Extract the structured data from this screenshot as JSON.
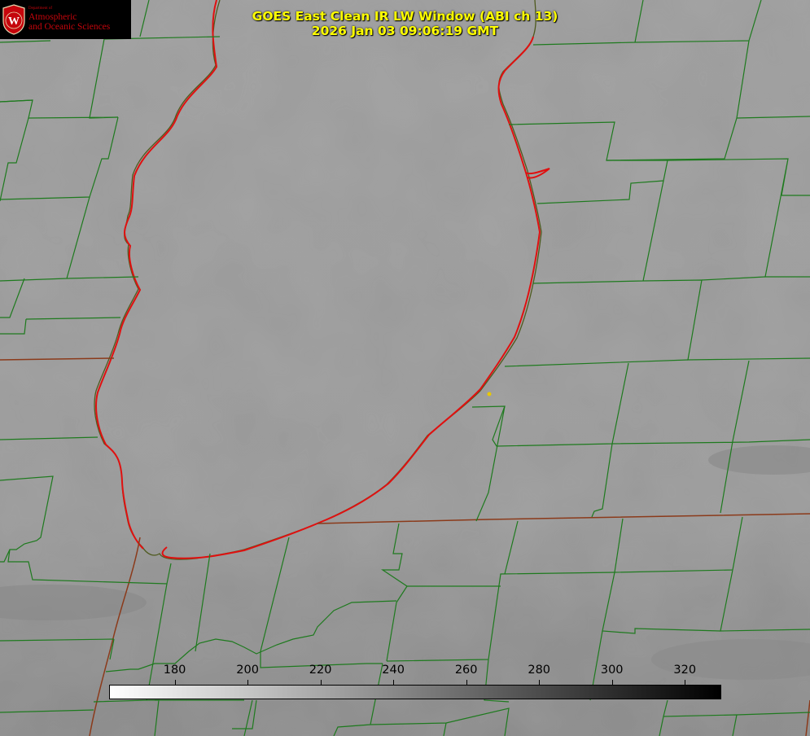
{
  "logo": {
    "department_label": "Department of",
    "line1": "Atmospheric",
    "line2": "and Oceanic Sciences",
    "seal_letter": "W"
  },
  "title": {
    "line1": "GOES East Clean IR LW Window (ABI ch 13)",
    "line2": "2026 Jan 03 09:06:19 GMT"
  },
  "colorbar": {
    "ticks": [
      "180",
      "200",
      "220",
      "240",
      "260",
      "280",
      "300",
      "320"
    ],
    "range": [
      162,
      330
    ],
    "gradient": "white-to-black"
  },
  "colors": {
    "background": "#9a9a9a",
    "county_lines": "#1e7a1e",
    "state_lines": "#8b3a1a",
    "coastline": "#e01010",
    "title_text": "#ffff00",
    "station_marker": "#e8c800"
  }
}
